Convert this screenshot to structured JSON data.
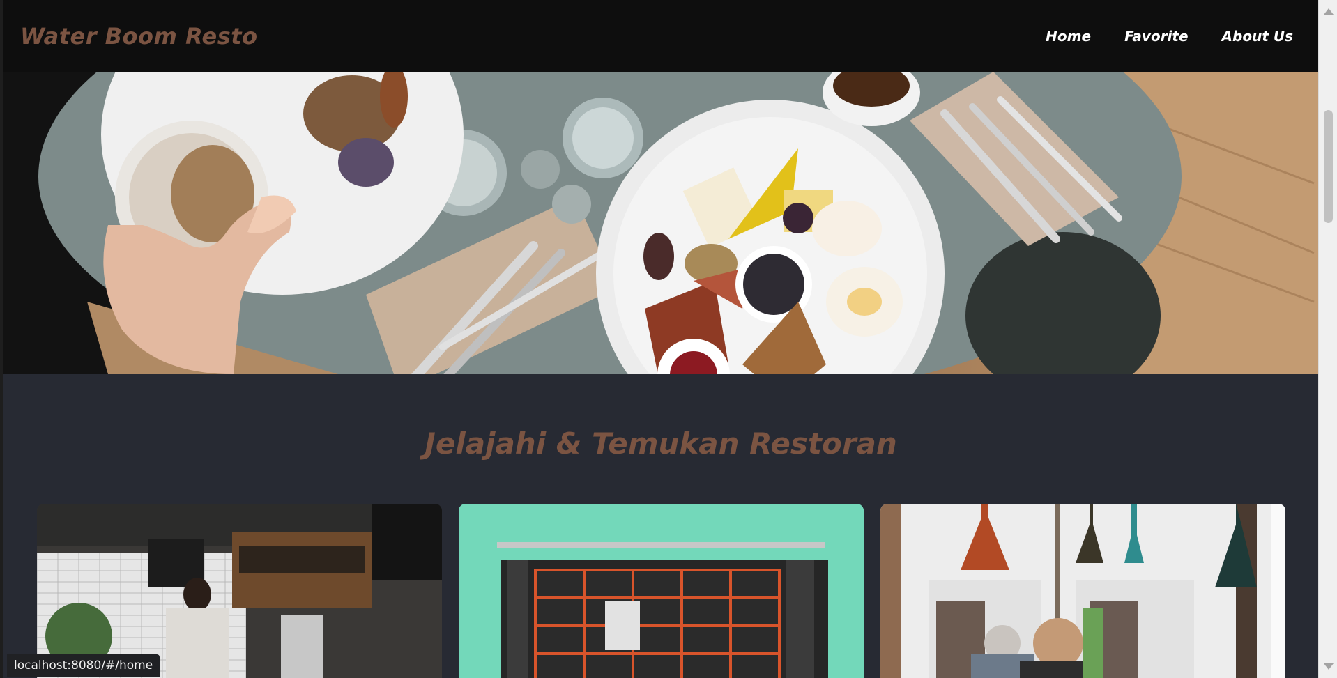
{
  "header": {
    "brand": "Water Boom Resto",
    "nav": [
      {
        "label": "Home"
      },
      {
        "label": "Favorite"
      },
      {
        "label": "About Us"
      }
    ]
  },
  "main": {
    "section_title": "Jelajahi & Temukan Restoran"
  },
  "status_bar": {
    "url": "localhost:8080/#/home"
  },
  "colors": {
    "header_bg": "#0e0e0e",
    "page_bg": "#272a33",
    "brand_accent": "#7b5442"
  }
}
